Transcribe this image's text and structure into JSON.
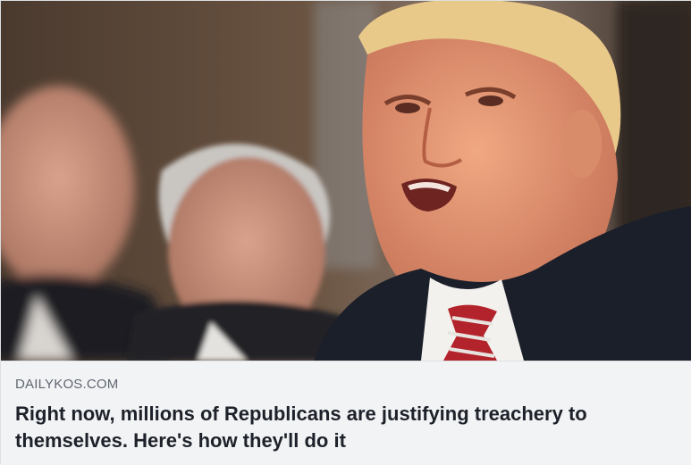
{
  "link_preview": {
    "image": {
      "description_icon": "news-photo"
    },
    "domain": "DAILYKOS.COM",
    "headline": "Right now, millions of Republicans are justifying treachery to themselves. Here's how they'll do it"
  },
  "colors": {
    "card_background": "#f2f3f5",
    "domain_text": "#606770",
    "headline_text": "#1d2129",
    "border": "#dddfe2"
  }
}
